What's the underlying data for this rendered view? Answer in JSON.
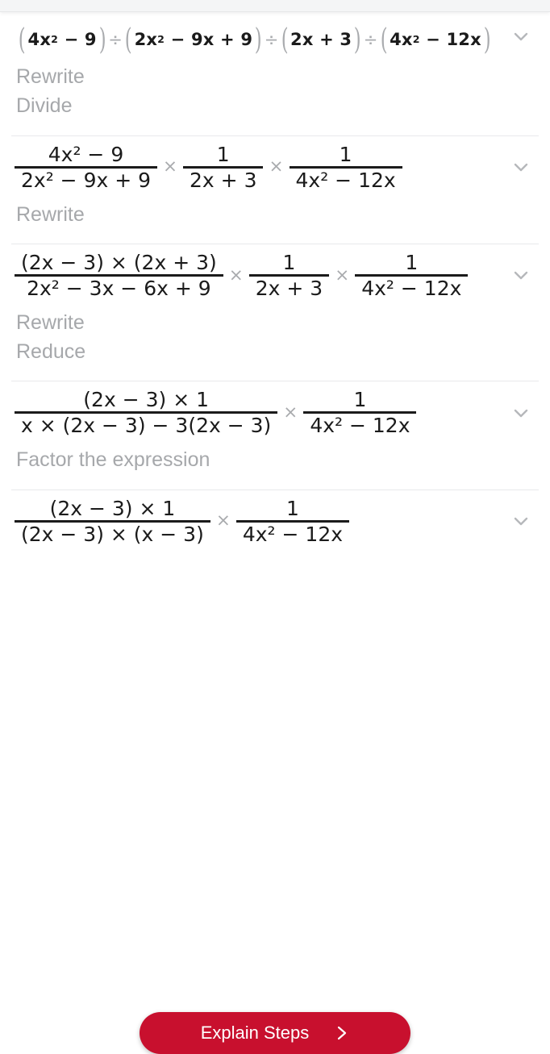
{
  "app": {
    "accent_color": "#c8102e",
    "text_color": "#1b1b1b",
    "muted_color": "#a6a8ab",
    "divider_color": "#e8e9eb"
  },
  "icons": {
    "expand": "chevron-down-icon",
    "cta_arrow": "chevron-right-icon"
  },
  "steps": [
    {
      "expression_plain": "(4x^2 - 9) ÷ (2x^2 - 9x + 9) ÷ (2x + 3) ÷ (4x^2 - 12x)",
      "expression_kind": "headline",
      "tokens": {
        "t1": "4x",
        "t1sup": "2",
        "t2": "− 9",
        "t3": "2x",
        "t3sup": "2",
        "t4": "− 9x + 9",
        "t5": "2x + 3",
        "t6": "4x",
        "t6sup": "2",
        "t7": "− 12x",
        "div": "÷"
      },
      "labels": [
        "Rewrite",
        "Divide"
      ]
    },
    {
      "expression_plain": "(4x^2 - 9)/(2x^2 - 9x + 9) × 1/(2x + 3) × 1/(4x^2 - 12x)",
      "expression_kind": "fraction",
      "fractions": [
        {
          "num": "4x² − 9",
          "den": "2x² − 9x + 9"
        },
        {
          "num": "1",
          "den": "2x + 3"
        },
        {
          "num": "1",
          "den": "4x² − 12x"
        }
      ],
      "labels": [
        "Rewrite"
      ]
    },
    {
      "expression_plain": "((2x - 3) × (2x + 3))/(2x^2 - 3x - 6x + 9) × 1/(2x + 3) × 1/(4x^2 - 12x)",
      "expression_kind": "fraction",
      "fractions": [
        {
          "num": "(2x − 3) × (2x + 3)",
          "den": "2x² − 3x − 6x + 9"
        },
        {
          "num": "1",
          "den": "2x + 3"
        },
        {
          "num": "1",
          "den": "4x² − 12x"
        }
      ],
      "labels": [
        "Rewrite",
        "Reduce"
      ]
    },
    {
      "expression_plain": "((2x - 3) × 1)/(x × (2x - 3) - 3(2x - 3)) × 1/(4x^2 - 12x)",
      "expression_kind": "fraction",
      "fractions": [
        {
          "num": "(2x − 3) × 1",
          "den": "x × (2x − 3) − 3(2x − 3)"
        },
        {
          "num": "1",
          "den": "4x² − 12x"
        }
      ],
      "labels": [
        "Factor the expression"
      ]
    },
    {
      "expression_plain": "((2x - 3) × 1)/((2x - 3) × (x - 3)) × 1/(4x^2 - 12x)",
      "expression_kind": "fraction",
      "fractions": [
        {
          "num": "(2x − 3) × 1",
          "den": "(2x − 3) × (x − 3)"
        },
        {
          "num": "1",
          "den": "4x² − 12x"
        }
      ],
      "labels": []
    }
  ],
  "operators": {
    "multiply": "×",
    "divide": "÷",
    "minus": "−"
  },
  "cta": {
    "label": "Explain Steps"
  }
}
